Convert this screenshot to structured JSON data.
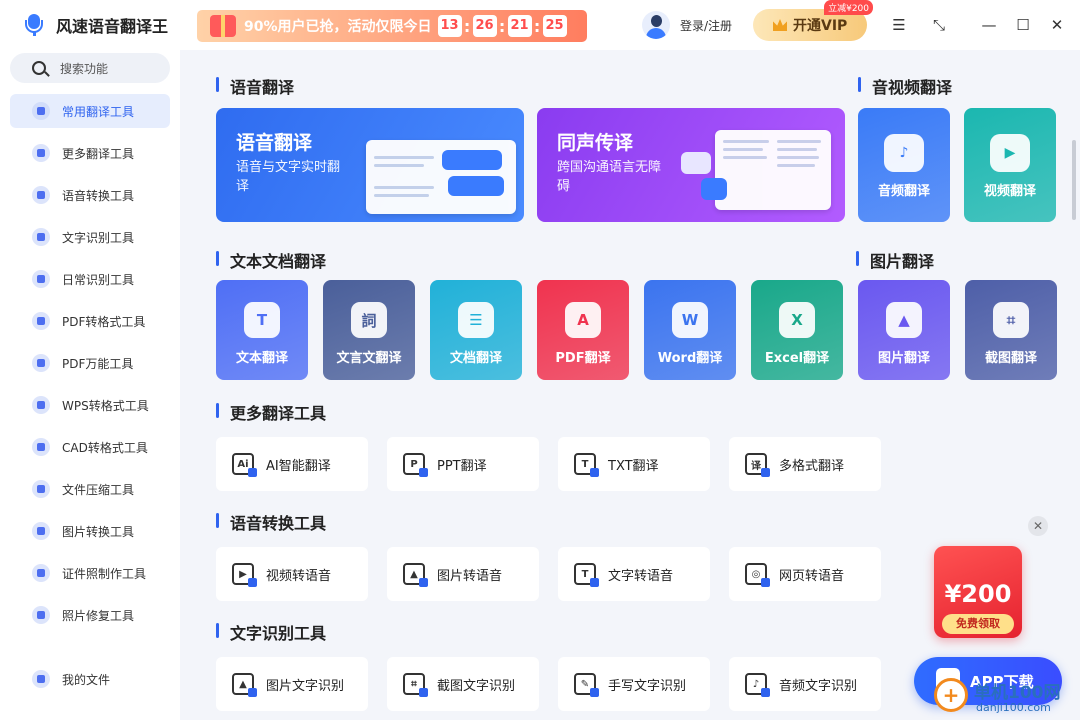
{
  "app": {
    "title": "风速语音翻译王"
  },
  "promo": {
    "text": "90%用户已抢，活动仅限今日",
    "countdown": [
      "13",
      "26",
      "21",
      "25"
    ]
  },
  "header": {
    "login": "登录/注册",
    "vip_label": "开通VIP",
    "vip_badge": "立减¥200"
  },
  "window_controls": {
    "menu": "☰",
    "mini": "⤡",
    "minimize": "—",
    "maximize": "☐",
    "close": "✕"
  },
  "sidebar": {
    "search_placeholder": "搜索功能",
    "items": [
      {
        "label": "常用翻译工具",
        "icon": "translate-icon",
        "active": true
      },
      {
        "label": "更多翻译工具",
        "icon": "list-icon"
      },
      {
        "label": "语音转换工具",
        "icon": "audio-icon"
      },
      {
        "label": "文字识别工具",
        "icon": "text-scan-icon"
      },
      {
        "label": "日常识别工具",
        "icon": "daily-scan-icon"
      },
      {
        "label": "PDF转格式工具",
        "icon": "pdf-icon"
      },
      {
        "label": "PDF万能工具",
        "icon": "pdf-tools-icon"
      },
      {
        "label": "WPS转格式工具",
        "icon": "wps-icon"
      },
      {
        "label": "CAD转格式工具",
        "icon": "cad-icon"
      },
      {
        "label": "文件压缩工具",
        "icon": "compress-icon"
      },
      {
        "label": "图片转换工具",
        "icon": "image-icon"
      },
      {
        "label": "证件照制作工具",
        "icon": "id-photo-icon"
      },
      {
        "label": "照片修复工具",
        "icon": "photo-repair-icon"
      }
    ],
    "my_files": "我的文件"
  },
  "sections": {
    "voice": "语音翻译",
    "av": "音视频翻译",
    "doc": "文本文档翻译",
    "image": "图片翻译",
    "more": "更多翻译工具",
    "speech": "语音转换工具",
    "ocr": "文字识别工具"
  },
  "banners": [
    {
      "title": "语音翻译",
      "subtitle": "语音与文字实时翻译",
      "color": "#2f6cf0"
    },
    {
      "title": "同声传译",
      "subtitle": "跨国沟通语言无障碍",
      "color": "#8a3cf0"
    }
  ],
  "av_tiles": [
    {
      "label": "音频翻译",
      "glyph": "♪",
      "color": "#3a7bf7"
    },
    {
      "label": "视频翻译",
      "glyph": "▶",
      "color": "#1bb7b0"
    }
  ],
  "doc_tiles": [
    {
      "label": "文本翻译",
      "glyph": "T",
      "color": "#4f6ff5"
    },
    {
      "label": "文言文翻译",
      "glyph": "詞",
      "color": "#4a5f9a"
    },
    {
      "label": "文档翻译",
      "glyph": "☰",
      "color": "#21b1d8"
    },
    {
      "label": "PDF翻译",
      "glyph": "A",
      "color": "#f0334f"
    },
    {
      "label": "Word翻译",
      "glyph": "W",
      "color": "#3b74ef"
    },
    {
      "label": "Excel翻译",
      "glyph": "X",
      "color": "#19a88a"
    },
    {
      "label": "图片翻译",
      "glyph": "▲",
      "color": "#6a58f0"
    },
    {
      "label": "截图翻译",
      "glyph": "⌗",
      "color": "#4e5fa8"
    }
  ],
  "more_tools": [
    {
      "label": "AI智能翻译",
      "glyph": "Ai"
    },
    {
      "label": "PPT翻译",
      "glyph": "P"
    },
    {
      "label": "TXT翻译",
      "glyph": "T"
    },
    {
      "label": "多格式翻译",
      "glyph": "译"
    }
  ],
  "speech_tools": [
    {
      "label": "视频转语音",
      "glyph": "▶"
    },
    {
      "label": "图片转语音",
      "glyph": "▲"
    },
    {
      "label": "文字转语音",
      "glyph": "T"
    },
    {
      "label": "网页转语音",
      "glyph": "◎"
    }
  ],
  "ocr_tools": [
    {
      "label": "图片文字识别",
      "glyph": "▲"
    },
    {
      "label": "截图文字识别",
      "glyph": "⌗"
    },
    {
      "label": "手写文字识别",
      "glyph": "✎"
    },
    {
      "label": "音频文字识别",
      "glyph": "♪"
    }
  ],
  "red_packet": {
    "amount": "¥200",
    "claim": "免费领取"
  },
  "app_download": "APP下载",
  "watermark": {
    "name": "单机100网",
    "url": "danji100.com"
  }
}
